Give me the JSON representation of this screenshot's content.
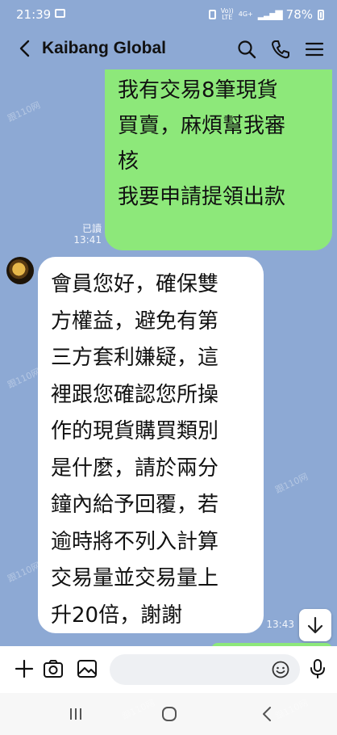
{
  "status_bar": {
    "time": "21:39",
    "network_top": "Vo))",
    "network_bottom": "LTE",
    "net_type": "4G+",
    "battery": "78%"
  },
  "header": {
    "title": "Kaibang Global",
    "back_icon": "back-arrow-icon",
    "search_icon": "search-icon",
    "call_icon": "phone-icon",
    "menu_icon": "hamburger-menu-icon"
  },
  "messages": {
    "outgoing": {
      "lines": [
        "我有交易8筆現貨",
        "買賣，麻煩幫我審",
        "核",
        "我要申請提領出款"
      ],
      "read_label": "已讀",
      "time": "13:41",
      "bubble_color": "#8de87a"
    },
    "incoming": {
      "lines": [
        "會員您好，確保雙",
        "方權益，避免有第",
        "三方套利嫌疑，這",
        "裡跟您確認您所操",
        "作的現貨購買類別",
        "是什麼，請於兩分",
        "鐘內給予回覆，若",
        "逾時將不列入計算",
        "交易量並交易量上",
        "升20倍，謝謝"
      ],
      "time": "13:43",
      "bubble_color": "#ffffff"
    }
  },
  "input_bar": {
    "plus_icon": "plus-icon",
    "camera_icon": "camera-icon",
    "image_icon": "image-icon",
    "emoji_icon": "emoji-icon",
    "mic_icon": "microphone-icon",
    "message_placeholder": ""
  },
  "nav_bar": {
    "recents_icon": "recents-icon",
    "home_icon": "home-icon",
    "back_icon": "back-icon"
  },
  "theme": {
    "chat_background": "#8da9d4",
    "outgoing_bubble": "#8de87a",
    "incoming_bubble": "#ffffff"
  },
  "watermark": "跟110网"
}
